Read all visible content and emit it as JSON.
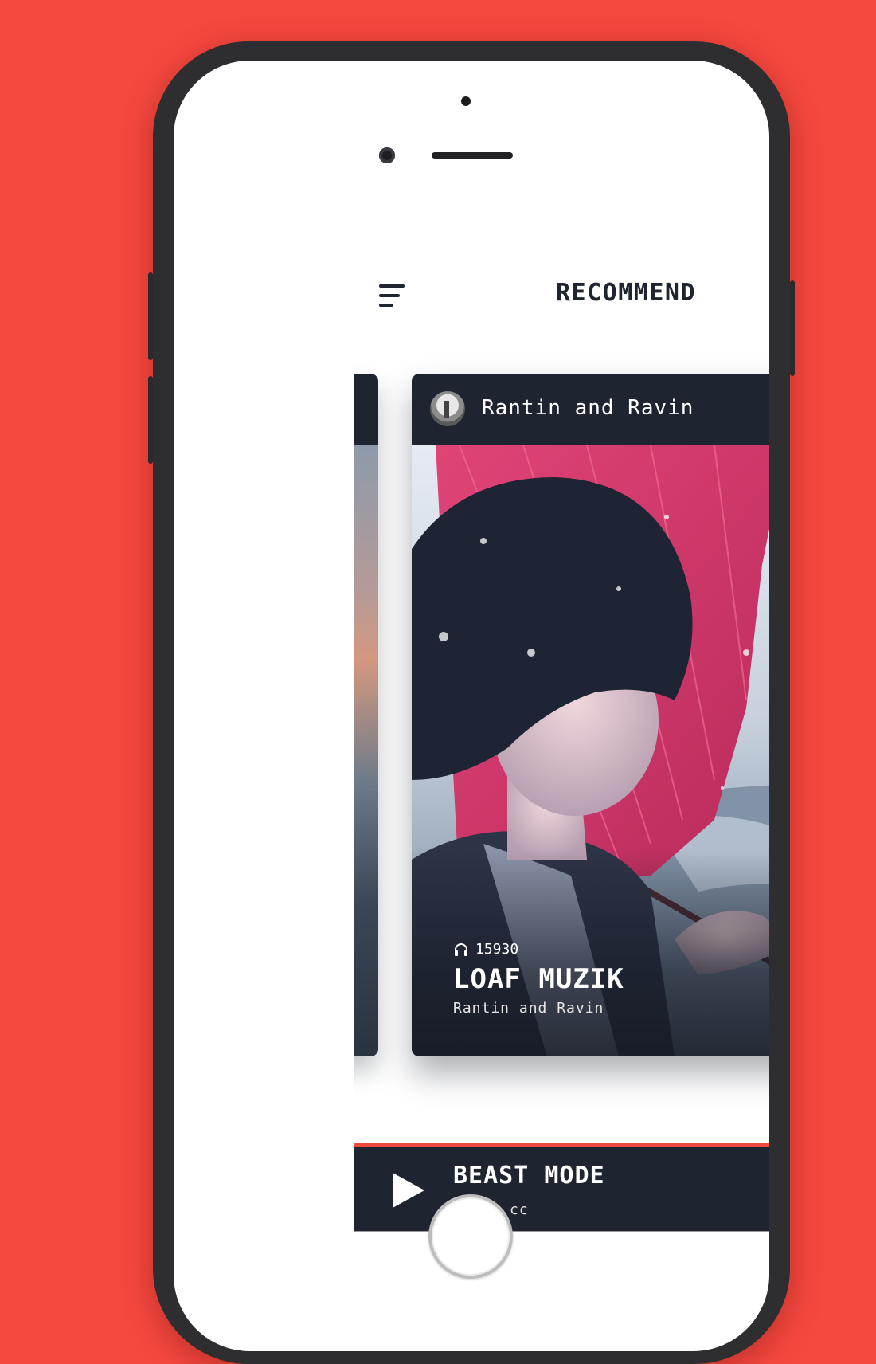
{
  "header": {
    "title": "RECOMMEND",
    "menu_icon": "menu-icon",
    "more_icon": "more-dots-icon"
  },
  "featured_card": {
    "user_name": "Rantin and Ravin",
    "plays": "15930",
    "plays_icon": "headphones-icon",
    "title": "LOAF MUZIK",
    "artist": "Rantin and Ravin"
  },
  "now_playing": {
    "title": "BEAST MODE",
    "artist": "Peter cc",
    "play_icon": "play-icon"
  },
  "colors": {
    "background": "#f5483f",
    "dark_navy": "#1f2530",
    "accent_red": "#f04a3f",
    "umbrella_pink": "#d63b6b"
  }
}
